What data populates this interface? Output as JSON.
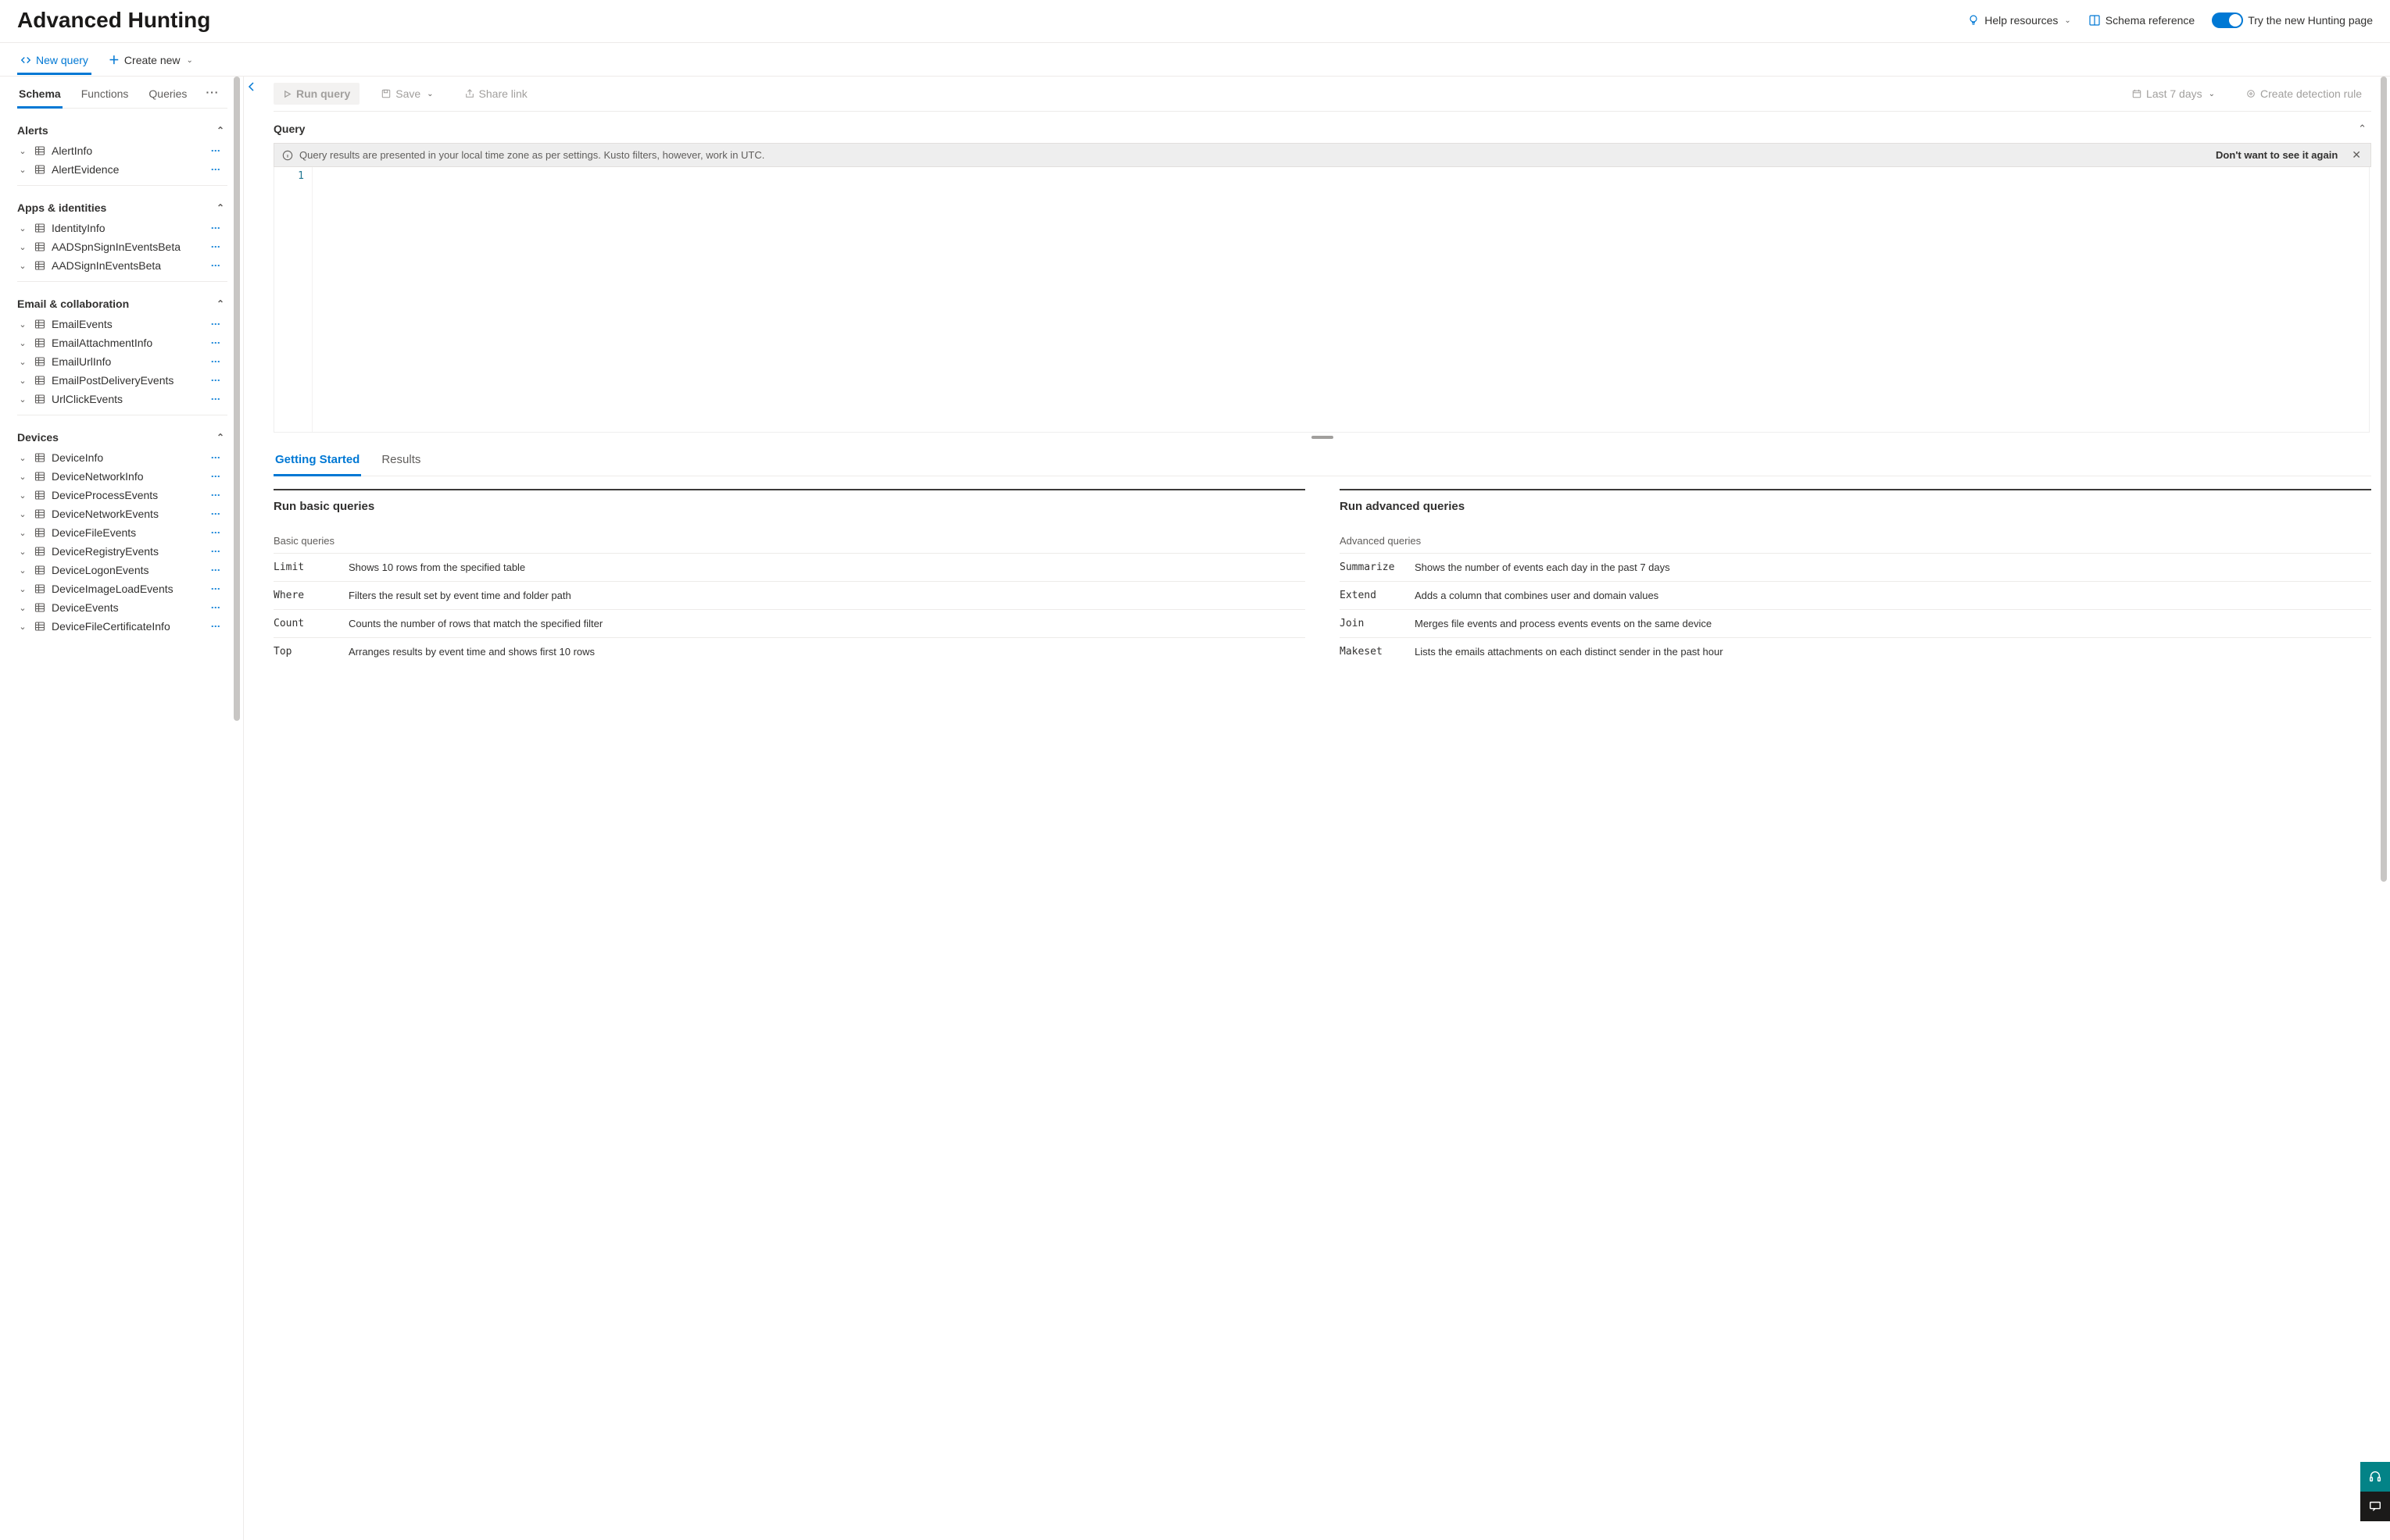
{
  "header": {
    "title": "Advanced Hunting",
    "help_label": "Help resources",
    "schema_ref_label": "Schema reference",
    "toggle_label": "Try the new Hunting page"
  },
  "top_tabs": {
    "new_query": "New query",
    "create_new": "Create new"
  },
  "sidebar": {
    "tabs": {
      "schema": "Schema",
      "functions": "Functions",
      "queries": "Queries"
    },
    "groups": [
      {
        "name": "Alerts",
        "items": [
          "AlertInfo",
          "AlertEvidence"
        ]
      },
      {
        "name": "Apps & identities",
        "items": [
          "IdentityInfo",
          "AADSpnSignInEventsBeta",
          "AADSignInEventsBeta"
        ]
      },
      {
        "name": "Email & collaboration",
        "items": [
          "EmailEvents",
          "EmailAttachmentInfo",
          "EmailUrlInfo",
          "EmailPostDeliveryEvents",
          "UrlClickEvents"
        ]
      },
      {
        "name": "Devices",
        "items": [
          "DeviceInfo",
          "DeviceNetworkInfo",
          "DeviceProcessEvents",
          "DeviceNetworkEvents",
          "DeviceFileEvents",
          "DeviceRegistryEvents",
          "DeviceLogonEvents",
          "DeviceImageLoadEvents",
          "DeviceEvents",
          "DeviceFileCertificateInfo"
        ]
      }
    ]
  },
  "toolbar": {
    "run": "Run query",
    "save": "Save",
    "share": "Share link",
    "time": "Last 7 days",
    "detection": "Create detection rule"
  },
  "query": {
    "heading": "Query",
    "info_text": "Query results are presented in your local time zone as per settings. Kusto filters, however, work in UTC.",
    "dismiss_label": "Don't want to see it again",
    "gutter_first": "1"
  },
  "bottom_tabs": {
    "getting_started": "Getting Started",
    "results": "Results"
  },
  "getting_started": {
    "basic_title": "Run basic queries",
    "basic_subhead": "Basic queries",
    "advanced_title": "Run advanced queries",
    "advanced_subhead": "Advanced queries",
    "basic": [
      {
        "k": "Limit",
        "d": "Shows 10 rows from the specified table"
      },
      {
        "k": "Where",
        "d": "Filters the result set by event time and folder path"
      },
      {
        "k": "Count",
        "d": "Counts the number of rows that match the specified filter"
      },
      {
        "k": "Top",
        "d": "Arranges results by event time and shows first 10 rows"
      }
    ],
    "advanced": [
      {
        "k": "Summarize",
        "d": "Shows the number of events each day in the past 7 days"
      },
      {
        "k": "Extend",
        "d": "Adds a column that combines user and domain values"
      },
      {
        "k": "Join",
        "d": "Merges file events and process events events on the same device"
      },
      {
        "k": "Makeset",
        "d": "Lists the emails attachments on each distinct sender in the past hour"
      }
    ]
  }
}
